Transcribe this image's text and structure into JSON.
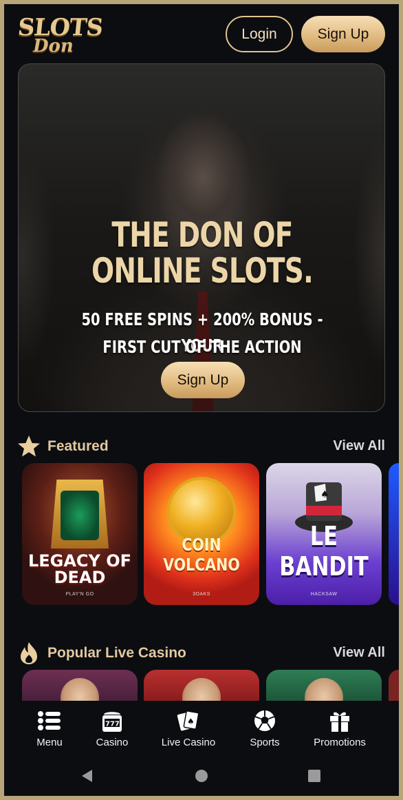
{
  "header": {
    "logo_line1": "SLOTS",
    "logo_line2": "Don",
    "login_label": "Login",
    "signup_label": "Sign Up"
  },
  "hero": {
    "title_line1": "THE DON OF",
    "title_line2": "ONLINE SLOTS.",
    "subtitle_line1": "50 FREE SPINS + 200% BONUS - YOUR",
    "subtitle_line2": "FIRST CUT OF THE ACTION",
    "cta_label": "Sign Up"
  },
  "featured": {
    "title": "Featured",
    "view_all": "View All",
    "games": [
      {
        "name_line1": "LEGACY OF",
        "name_line2": "DEAD",
        "provider": "PLAY'N GO"
      },
      {
        "name": "COIN VOLCANO",
        "provider": "3OAKS"
      },
      {
        "name": "LE BANDIT",
        "provider": "HACKSAW"
      }
    ]
  },
  "live_casino": {
    "title": "Popular Live Casino",
    "view_all": "View All"
  },
  "bottom_nav": {
    "items": [
      {
        "label": "Menu",
        "icon": "menu-icon"
      },
      {
        "label": "Casino",
        "icon": "slot-machine-icon"
      },
      {
        "label": "Live Casino",
        "icon": "cards-icon"
      },
      {
        "label": "Sports",
        "icon": "soccer-ball-icon"
      },
      {
        "label": "Promotions",
        "icon": "gift-icon"
      }
    ]
  },
  "colors": {
    "background": "#0c0d11",
    "gold_accent": "#e2bc82",
    "section_title": "#e1c9a0",
    "frame": "#b8a578"
  }
}
